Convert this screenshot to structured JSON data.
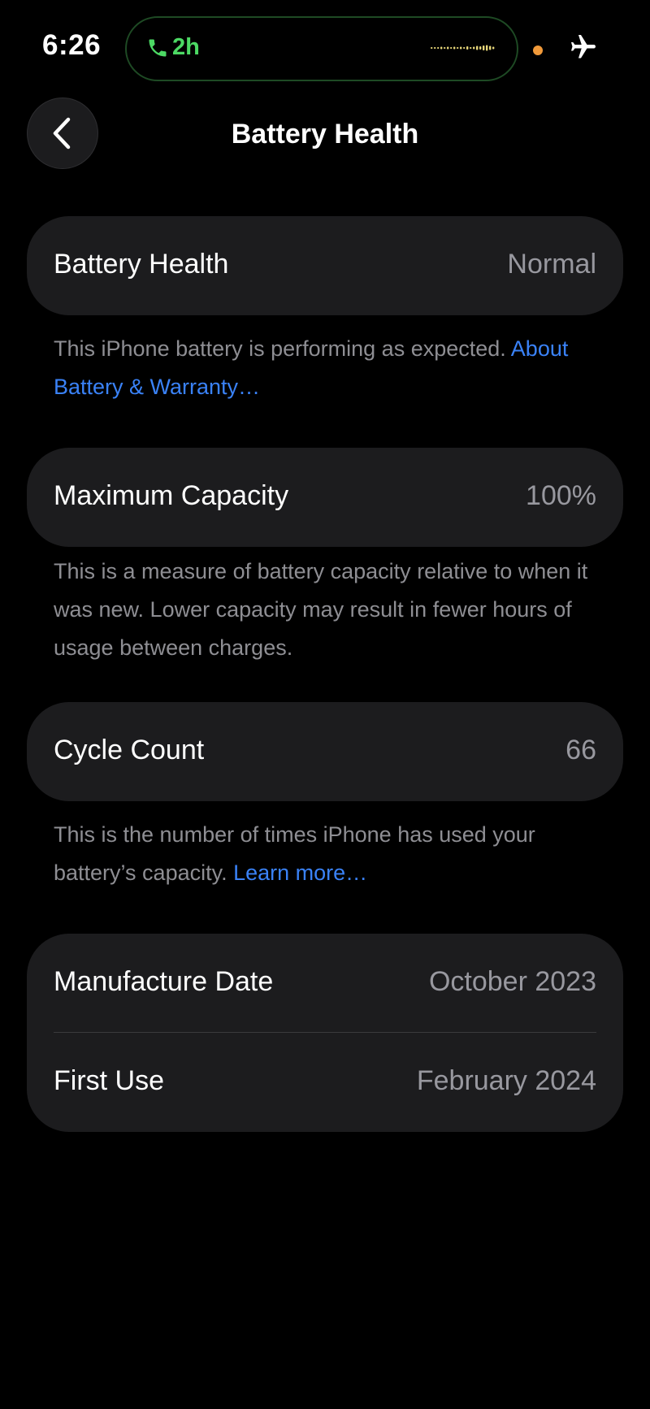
{
  "status_bar": {
    "time": "6:26",
    "call_duration": "2h",
    "icons": [
      "phone-icon",
      "waveform-icon",
      "mic-indicator-dot",
      "airplane-mode-icon"
    ],
    "call_color": "#4cd964",
    "indicator_color": "#f19a3a"
  },
  "nav": {
    "title": "Battery Health",
    "back_icon": "chevron-left-icon"
  },
  "battery_health": {
    "label": "Battery Health",
    "value": "Normal",
    "footnote": "This iPhone battery is performing as expected. ",
    "footnote_link": "About Battery & Warranty…"
  },
  "maximum_capacity": {
    "label": "Maximum Capacity",
    "value": "100%",
    "footnote": "This is a measure of battery capacity relative to when it was new. Lower capacity may result in fewer hours of usage between charges."
  },
  "cycle_count": {
    "label": "Cycle Count",
    "value": "66",
    "footnote": "This is the number of times iPhone has used your battery’s capacity. ",
    "footnote_link": "Learn more…"
  },
  "dates": {
    "manufacture_label": "Manufacture Date",
    "manufacture_value": "October 2023",
    "first_use_label": "First Use",
    "first_use_value": "February 2024"
  },
  "colors": {
    "background": "#000000",
    "card": "#1c1c1e",
    "secondary_text": "#98989f",
    "footnote_text": "#8e8e93",
    "link": "#3a82f7"
  }
}
